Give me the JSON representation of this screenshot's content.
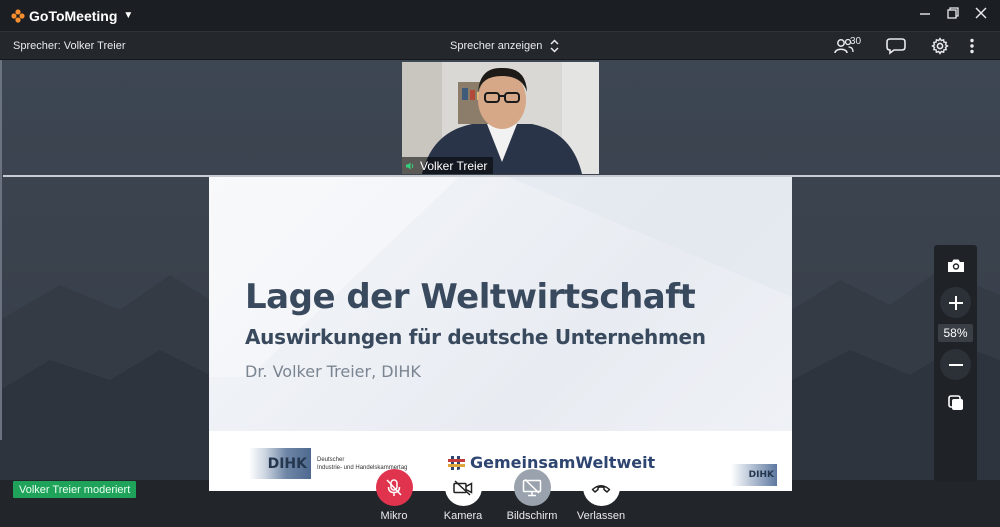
{
  "app": {
    "name": "GoToMeeting"
  },
  "toolbar": {
    "speaker_label": "Sprecher: Volker Treier",
    "view_toggle": "Sprecher anzeigen",
    "attendee_count": "30"
  },
  "webcam": {
    "participant_name": "Volker Treier"
  },
  "slide": {
    "title": "Lage der Weltwirtschaft",
    "subtitle": "Auswirkungen für deutsche Unternehmen",
    "author": "Dr. Volker Treier, DIHK",
    "logo_left_abbr": "DIHK",
    "logo_left_line1": "Deutscher",
    "logo_left_line2": "Industrie- und Handelskammertag",
    "logo_center": "GemeinsamWeltweit",
    "logo_right_abbr": "DIHK"
  },
  "zoom": {
    "level": "58%"
  },
  "status": {
    "moderator_badge": "Volker Treier moderiert"
  },
  "controls": [
    {
      "label": "Mikro",
      "color": "#e0334e",
      "icon": "mic-muted-icon"
    },
    {
      "label": "Kamera",
      "color": "#ffffff",
      "icon": "camera-off-icon"
    },
    {
      "label": "Bildschirm",
      "color": "#9aa3ad",
      "icon": "screen-share-off-icon"
    },
    {
      "label": "Verlassen",
      "color": "#ffffff",
      "icon": "hang-up-icon"
    }
  ],
  "colors": {
    "accent_green": "#1fa35b",
    "brand_orange": "#f68d2e"
  }
}
